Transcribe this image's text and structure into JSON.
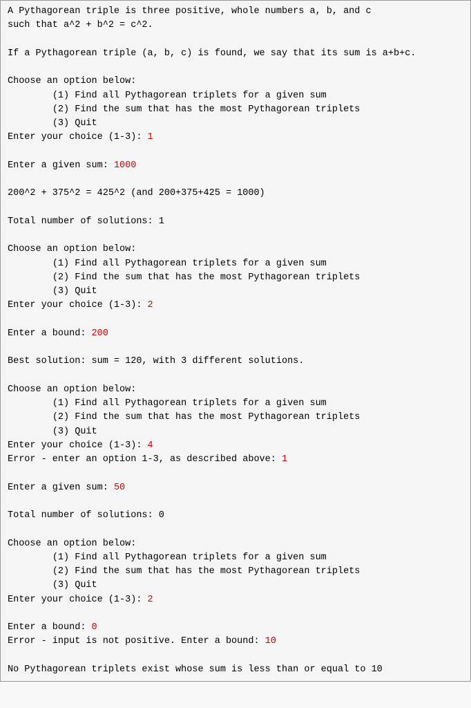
{
  "lines": [
    {
      "text": "A Pythagorean triple is three positive, whole numbers a, b, and c"
    },
    {
      "text": "such that a^2 + b^2 = c^2."
    },
    {
      "text": ""
    },
    {
      "text": "If a Pythagorean triple (a, b, c) is found, we say that its sum is a+b+c."
    },
    {
      "text": ""
    },
    {
      "text": "Choose an option below:"
    },
    {
      "text": "        (1) Find all Pythagorean triplets for a given sum"
    },
    {
      "text": "        (2) Find the sum that has the most Pythagorean triplets"
    },
    {
      "text": "        (3) Quit"
    },
    {
      "prompt": "Enter your choice (1-3): ",
      "input": "1"
    },
    {
      "text": ""
    },
    {
      "prompt": "Enter a given sum: ",
      "input": "1000"
    },
    {
      "text": ""
    },
    {
      "text": "200^2 + 375^2 = 425^2 (and 200+375+425 = 1000)"
    },
    {
      "text": ""
    },
    {
      "text": "Total number of solutions: 1"
    },
    {
      "text": ""
    },
    {
      "text": "Choose an option below:"
    },
    {
      "text": "        (1) Find all Pythagorean triplets for a given sum"
    },
    {
      "text": "        (2) Find the sum that has the most Pythagorean triplets"
    },
    {
      "text": "        (3) Quit"
    },
    {
      "prompt": "Enter your choice (1-3): ",
      "input": "2"
    },
    {
      "text": ""
    },
    {
      "prompt": "Enter a bound: ",
      "input": "200"
    },
    {
      "text": ""
    },
    {
      "text": "Best solution: sum = 120, with 3 different solutions."
    },
    {
      "text": ""
    },
    {
      "text": "Choose an option below:"
    },
    {
      "text": "        (1) Find all Pythagorean triplets for a given sum"
    },
    {
      "text": "        (2) Find the sum that has the most Pythagorean triplets"
    },
    {
      "text": "        (3) Quit"
    },
    {
      "prompt": "Enter your choice (1-3): ",
      "input": "4"
    },
    {
      "prompt": "Error - enter an option 1-3, as described above: ",
      "input": "1"
    },
    {
      "text": ""
    },
    {
      "prompt": "Enter a given sum: ",
      "input": "50"
    },
    {
      "text": ""
    },
    {
      "text": "Total number of solutions: 0"
    },
    {
      "text": ""
    },
    {
      "text": "Choose an option below:"
    },
    {
      "text": "        (1) Find all Pythagorean triplets for a given sum"
    },
    {
      "text": "        (2) Find the sum that has the most Pythagorean triplets"
    },
    {
      "text": "        (3) Quit"
    },
    {
      "prompt": "Enter your choice (1-3): ",
      "input": "2"
    },
    {
      "text": ""
    },
    {
      "prompt": "Enter a bound: ",
      "input": "0"
    },
    {
      "prompt": "Error - input is not positive. Enter a bound: ",
      "input": "10"
    },
    {
      "text": ""
    },
    {
      "text": "No Pythagorean triplets exist whose sum is less than or equal to 10"
    }
  ]
}
